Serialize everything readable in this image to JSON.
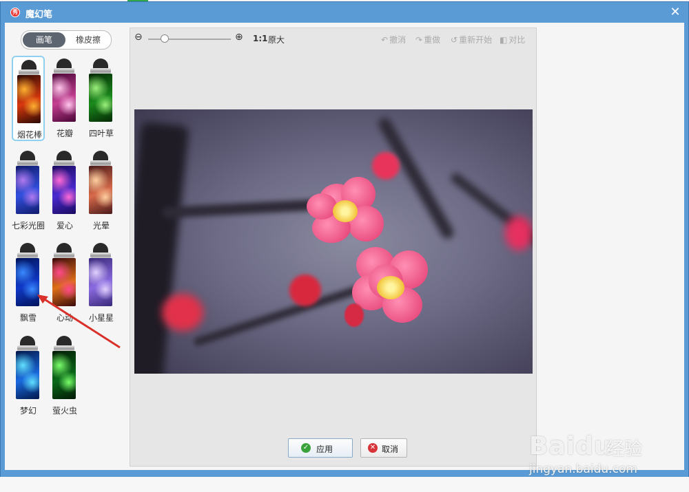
{
  "dialog": {
    "title": "魔幻笔",
    "close_glyph": "✕"
  },
  "mode_tabs": [
    {
      "label": "画笔",
      "selected": true
    },
    {
      "label": "橡皮擦",
      "selected": false
    }
  ],
  "brushes": [
    {
      "label": "烟花棒",
      "selected": true,
      "colors": [
        "#2b0a05",
        "#d8380e",
        "#ffb030"
      ]
    },
    {
      "label": "花瓣",
      "selected": false,
      "colors": [
        "#4a0636",
        "#c43f92",
        "#ffc6ec"
      ]
    },
    {
      "label": "四叶草",
      "selected": false,
      "colors": [
        "#052a06",
        "#1a8a1c",
        "#9af07a"
      ]
    },
    {
      "label": "七彩光圈",
      "selected": false,
      "colors": [
        "#101a6a",
        "#3250e0",
        "#b07af0"
      ]
    },
    {
      "label": "爱心",
      "selected": false,
      "colors": [
        "#1a0a60",
        "#4a2ad0",
        "#ff6ad8"
      ]
    },
    {
      "label": "光晕",
      "selected": false,
      "colors": [
        "#4a1a1a",
        "#d86a4a",
        "#ffd0a0"
      ]
    },
    {
      "label": "飘雪",
      "selected": false,
      "colors": [
        "#02145a",
        "#1038c8",
        "#3a8aff"
      ]
    },
    {
      "label": "心动",
      "selected": false,
      "colors": [
        "#3a0a0a",
        "#e0701a",
        "#ff4a8a"
      ]
    },
    {
      "label": "小星星",
      "selected": false,
      "colors": [
        "#3a2a7a",
        "#8a6ae0",
        "#e0d0ff"
      ]
    },
    {
      "label": "梦幻",
      "selected": false,
      "colors": [
        "#02184a",
        "#1a6ae0",
        "#60e0ff"
      ]
    },
    {
      "label": "萤火虫",
      "selected": false,
      "colors": [
        "#031a05",
        "#0a6a1a",
        "#7aff6a"
      ]
    }
  ],
  "toolbar": {
    "zoom_out_glyph": "⊖",
    "zoom_in_glyph": "⊕",
    "zoom_level": 0.2,
    "ratio_label": "1:1",
    "actual_size_label": "原大",
    "undo_label": "撤消",
    "redo_label": "重做",
    "restart_label": "重新开始",
    "compare_label": "对比"
  },
  "actions": {
    "apply_label": "应用",
    "cancel_label": "取消"
  },
  "watermark": {
    "logo": "Baidu",
    "jingyan": "经验",
    "url": "jingyan.baidu.com"
  },
  "colors": {
    "title_bar": "#5a9bd5",
    "selected_tab": "#5d6670",
    "selection_border": "#8ed0ee",
    "annotation_arrow": "#d9302a"
  }
}
